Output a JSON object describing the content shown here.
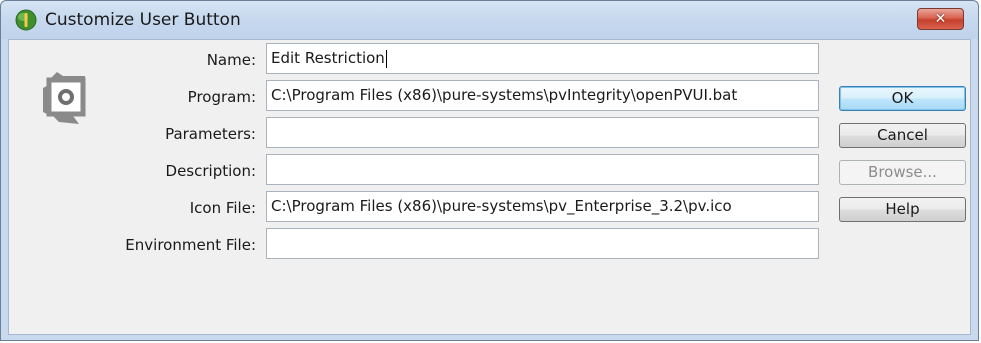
{
  "window": {
    "title": "Customize User Button",
    "close_glyph": "✕"
  },
  "icons": {
    "app_icon": "info-leaf-icon",
    "tool_icon": "user-button-tool-icon"
  },
  "form": {
    "name": {
      "label": "Name:",
      "value": "Edit Restriction"
    },
    "program": {
      "label": "Program:",
      "value": "C:\\Program Files (x86)\\pure-systems\\pvIntegrity\\openPVUI.bat"
    },
    "parameters": {
      "label": "Parameters:",
      "value": ""
    },
    "description": {
      "label": "Description:",
      "value": ""
    },
    "icon_file": {
      "label": "Icon File:",
      "value": "C:\\Program Files (x86)\\pure-systems\\pv_Enterprise_3.2\\pv.ico"
    },
    "environment_file": {
      "label": "Environment File:",
      "value": ""
    }
  },
  "buttons": {
    "ok": "OK",
    "cancel": "Cancel",
    "browse": "Browse...",
    "help": "Help"
  },
  "colors": {
    "title_bar": "#c6d8ee",
    "client_bg": "#f0f0f0",
    "close_red": "#c6402c",
    "default_button_blue": "#bee6fd"
  }
}
